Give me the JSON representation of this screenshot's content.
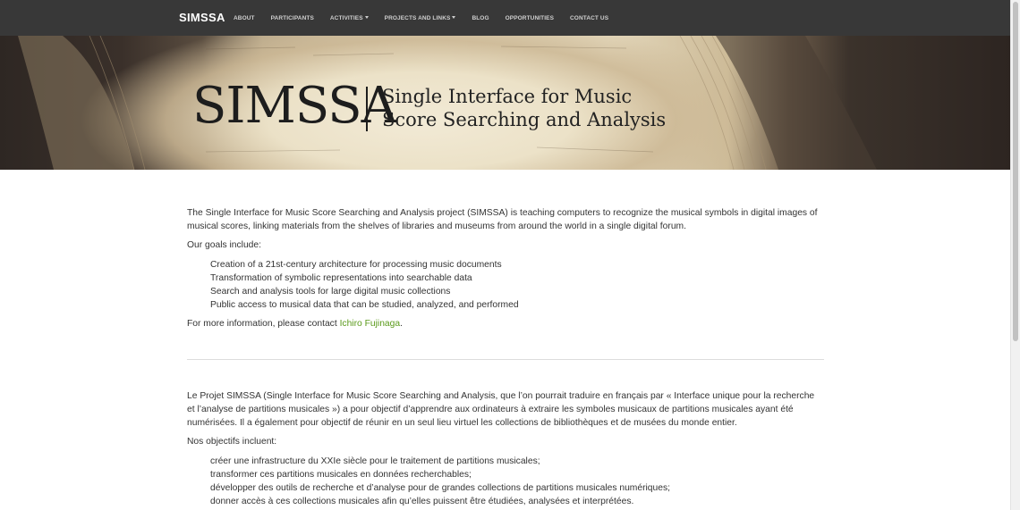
{
  "nav": {
    "brand": "SIMSSA",
    "items": [
      {
        "label": "About",
        "caret": false
      },
      {
        "label": "Participants",
        "caret": false
      },
      {
        "label": "Activities",
        "caret": true
      },
      {
        "label": "Projects and Links",
        "caret": true
      },
      {
        "label": "Blog",
        "caret": false
      },
      {
        "label": "Opportunities",
        "caret": false
      },
      {
        "label": "Contact Us",
        "caret": false
      }
    ]
  },
  "hero": {
    "logo": "SIMSSA",
    "tagline_line1": "Single Interface for Music",
    "tagline_line2": "Score Searching and Analysis"
  },
  "english": {
    "intro": "The Single Interface for Music Score Searching and Analysis project (SIMSSA) is teaching computers to recognize the musical symbols in digital images of musical scores, linking materials from the shelves of libraries and museums from around the world in a single digital forum.",
    "goals_heading": "Our goals include:",
    "goals": [
      "Creation of a 21st-century architecture for processing music documents",
      "Transformation of symbolic representations into searchable data",
      "Search and analysis tools for large digital music collections",
      "Public access to musical data that can be studied, analyzed, and performed"
    ],
    "contact_prefix": "For more information, please contact ",
    "contact_name": "Ichiro Fujinaga",
    "contact_suffix": "."
  },
  "french": {
    "intro": "Le Projet SIMSSA (Single Interface for Music Score Searching and Analysis, que l’on pourrait traduire en français par « Interface unique pour la recherche et l’analyse de partitions musicales ») a pour objectif d’apprendre aux ordinateurs à extraire les symboles musicaux de partitions musicales ayant été numérisées. Il a également pour objectif de réunir en un seul lieu virtuel les collections de bibliothèques et de musées du monde entier.",
    "goals_heading": "Nos objectifs incluent:",
    "goals": [
      "créer une infrastructure du XXIe siècle pour le traitement de partitions musicales;",
      "transformer ces partitions musicales en données recherchables;",
      "développer des outils de recherche et d’analyse pour de grandes collections de partitions musicales numériques;",
      "donner accès à ces collections musicales afin qu’elles puissent être étudiées, analysées et interprétées."
    ]
  },
  "colors": {
    "navbar": "#383838",
    "link": "#5a9a1a"
  }
}
